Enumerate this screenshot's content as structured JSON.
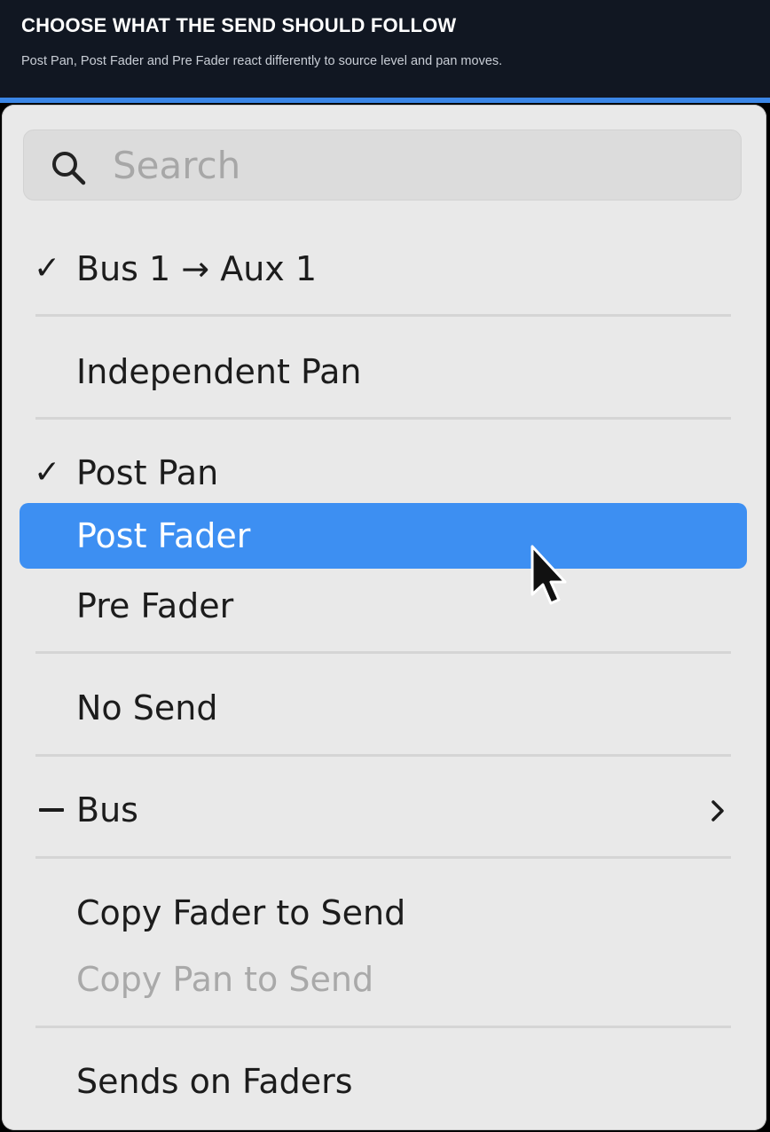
{
  "header": {
    "title": "CHOOSE WHAT THE SEND SHOULD FOLLOW",
    "subtitle": "Post Pan, Post Fader and Pre Fader react differently to source level and pan moves."
  },
  "search": {
    "placeholder": "Search",
    "value": "",
    "icon": "search-icon"
  },
  "menu": {
    "items": [
      {
        "label": "Bus 1 → Aux 1",
        "mark": "✓",
        "state": "checked"
      },
      {
        "label": "Independent Pan",
        "mark": "",
        "state": "normal"
      },
      {
        "label": "Post Pan",
        "mark": "✓",
        "state": "checked"
      },
      {
        "label": "Post Fader",
        "mark": "",
        "state": "highlighted"
      },
      {
        "label": "Pre Fader",
        "mark": "",
        "state": "normal"
      },
      {
        "label": "No Send",
        "mark": "",
        "state": "normal"
      },
      {
        "label": "Bus",
        "mark": "–",
        "state": "mixed",
        "submenu": true
      },
      {
        "label": "Copy Fader to Send",
        "mark": "",
        "state": "normal"
      },
      {
        "label": "Copy Pan to Send",
        "mark": "",
        "state": "disabled"
      },
      {
        "label": "Sends on Faders",
        "mark": "",
        "state": "normal"
      }
    ]
  },
  "colors": {
    "highlight": "#3d8ff2",
    "accent_bar": "#3b86e6",
    "header_bg": "#111722",
    "menu_bg": "#e9e9e9"
  }
}
